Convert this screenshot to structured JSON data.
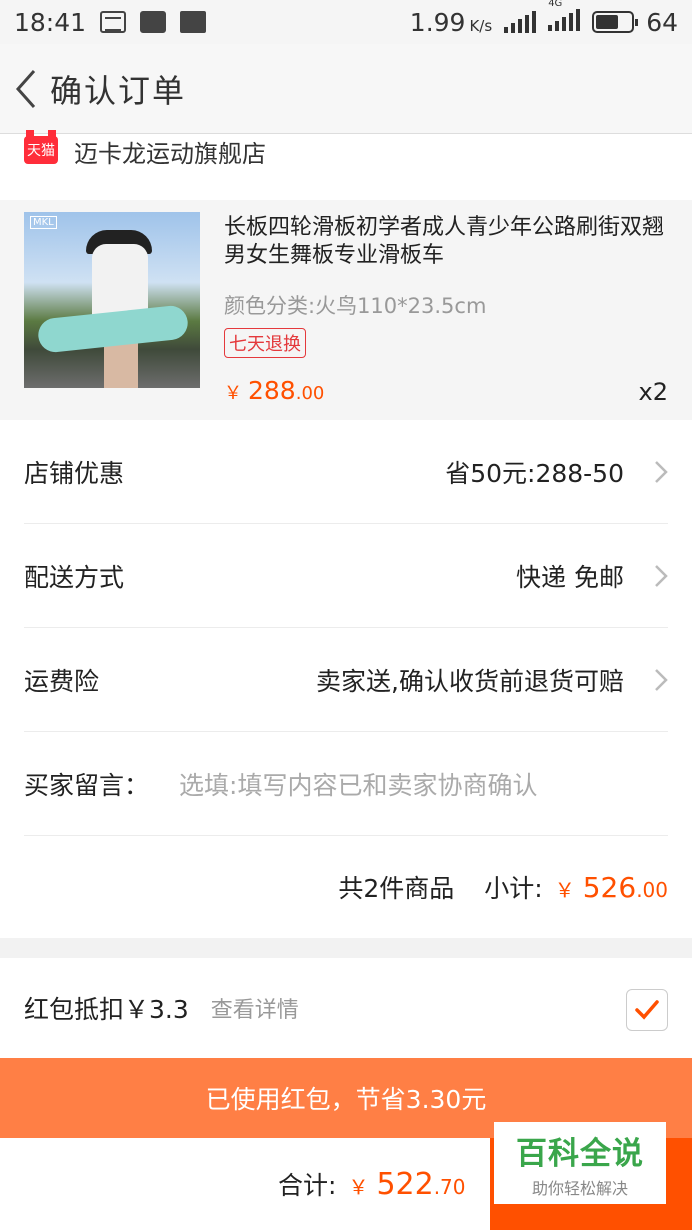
{
  "status_bar": {
    "time": "18:41",
    "net_speed": "1.99",
    "net_unit": "K/s",
    "network_type": "4G",
    "battery": "64",
    "battery_fraction": 0.64
  },
  "header": {
    "title": "确认订单"
  },
  "shop": {
    "badge": "天猫",
    "name": "迈卡龙运动旗舰店"
  },
  "product": {
    "thumb_logo": "MKL",
    "title": "长板四轮滑板初学者成人青少年公路刷街双翘男女生舞板专业滑板车",
    "spec": "颜色分类:火鸟110*23.5cm",
    "tag": "七天退换",
    "price_currency": "￥",
    "price_int": "288",
    "price_dec": ".00",
    "quantity": "x2"
  },
  "rows": {
    "discount": {
      "label": "店铺优惠",
      "value": "省50元:288-50"
    },
    "delivery": {
      "label": "配送方式",
      "value": "快递 免邮"
    },
    "insurance": {
      "label": "运费险",
      "value": "卖家送,确认收货前退货可赔"
    },
    "message": {
      "label": "买家留言：",
      "placeholder": "选填:填写内容已和卖家协商确认"
    }
  },
  "subtotal": {
    "count": "共2件商品",
    "label": "小计:",
    "currency": "￥",
    "int": "526",
    "dec": ".00"
  },
  "red_packet": {
    "label": "红包抵扣￥3.3",
    "link": "查看详情",
    "checked": true
  },
  "banner": {
    "text": "已使用红包，节省3.30元"
  },
  "total": {
    "label": "合计:",
    "currency": "￥",
    "int": "522",
    "dec": ".70"
  },
  "watermark": {
    "main": "百科全说",
    "sub": "助你轻松解决"
  },
  "colors": {
    "accent": "#ff5000",
    "banner": "#ff7f45",
    "tmall": "#ff2d3a",
    "watermark": "#3aa64b"
  }
}
